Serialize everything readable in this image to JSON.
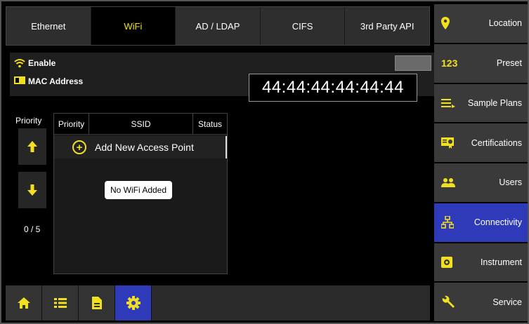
{
  "tabs": [
    {
      "label": "Ethernet",
      "active": false
    },
    {
      "label": "WiFi",
      "active": true
    },
    {
      "label": "AD / LDAP",
      "active": false
    },
    {
      "label": "CIFS",
      "active": false
    },
    {
      "label": "3rd Party API",
      "active": false
    }
  ],
  "enable": {
    "label": "Enable",
    "icon": "wifi-icon"
  },
  "mac": {
    "label": "MAC Address",
    "value": "44:44:44:44:44:44",
    "icon": "id-card-icon"
  },
  "priority": {
    "heading": "Priority",
    "count": "0 / 5"
  },
  "table": {
    "headers": {
      "priority": "Priority",
      "ssid": "SSID",
      "status": "Status"
    },
    "add_label": "Add New Access Point",
    "empty_message": "No WiFi Added"
  },
  "sidebar": [
    {
      "label": "Location",
      "icon": "location-pin-icon",
      "active": false
    },
    {
      "label": "Preset",
      "icon": "preset-123-icon",
      "active": false
    },
    {
      "label": "Sample Plans",
      "icon": "list-arrow-icon",
      "active": false
    },
    {
      "label": "Certifications",
      "icon": "certificate-icon",
      "active": false
    },
    {
      "label": "Users",
      "icon": "users-icon",
      "active": false
    },
    {
      "label": "Connectivity",
      "icon": "network-icon",
      "active": true
    },
    {
      "label": "Instrument",
      "icon": "instrument-icon",
      "active": false
    },
    {
      "label": "Service",
      "icon": "wrench-icon",
      "active": false
    }
  ],
  "colors": {
    "accent": "#f0e020",
    "active_blue": "#2e3ab8"
  }
}
